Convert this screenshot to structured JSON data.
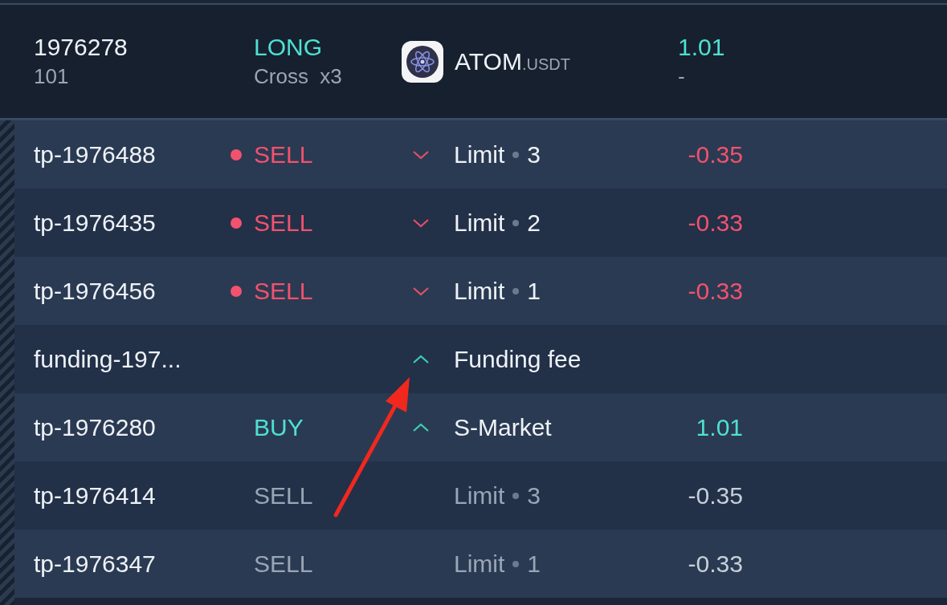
{
  "position": {
    "id": "1976278",
    "sub_id": "101",
    "side": "LONG",
    "margin": "Cross  x3",
    "symbol": "ATOM",
    "quote": ".USDT",
    "amount": "1.01",
    "amount_sub": "-"
  },
  "orders": [
    {
      "id": "tp-1976488",
      "side": "SELL",
      "kind": "sell",
      "highlighted": true,
      "dot": true,
      "chevron": true,
      "rising": false,
      "type": "Limit",
      "qty": "3",
      "amount": "-0.35"
    },
    {
      "id": "tp-1976435",
      "side": "SELL",
      "kind": "sell",
      "highlighted": true,
      "dot": true,
      "chevron": true,
      "rising": false,
      "type": "Limit",
      "qty": "2",
      "amount": "-0.33"
    },
    {
      "id": "tp-1976456",
      "side": "SELL",
      "kind": "sell",
      "highlighted": true,
      "dot": true,
      "chevron": true,
      "rising": false,
      "type": "Limit",
      "qty": "1",
      "amount": "-0.33"
    },
    {
      "id": "funding-197...",
      "highlighted": true,
      "dot": false,
      "chevron": true,
      "rising": true,
      "type": "Funding fee"
    },
    {
      "id": "tp-1976280",
      "side": "BUY",
      "kind": "buy",
      "highlighted": true,
      "dot": false,
      "chevron": true,
      "rising": true,
      "type": "S-Market",
      "amount": "1.01"
    },
    {
      "id": "tp-1976414",
      "side": "SELL",
      "kind": "sell",
      "highlighted": false,
      "dot": false,
      "chevron": false,
      "type": "Limit",
      "qty": "3",
      "amount": "-0.35"
    },
    {
      "id": "tp-1976347",
      "side": "SELL",
      "kind": "sell",
      "highlighted": false,
      "dot": false,
      "chevron": false,
      "type": "Limit",
      "qty": "1",
      "amount": "-0.33"
    }
  ]
}
